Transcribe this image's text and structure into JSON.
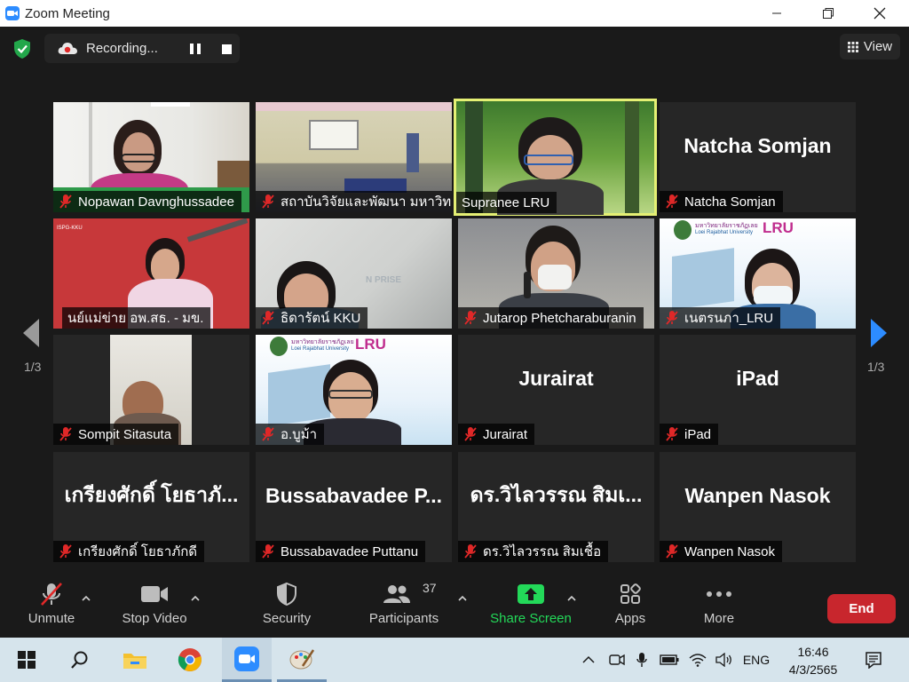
{
  "window": {
    "title": "Zoom Meeting"
  },
  "recording": {
    "label": "Recording..."
  },
  "view": {
    "label": "View"
  },
  "paging": {
    "left": "1/3",
    "right": "1/3"
  },
  "participants_tiles": [
    {
      "name": "Nopawan Davnghussadee",
      "display": "",
      "muted": true,
      "video": true
    },
    {
      "name": "สถาบันวิจัยและพัฒนา มหาวิท...",
      "display": "",
      "muted": true,
      "video": true
    },
    {
      "name": "Supranee LRU",
      "display": "",
      "muted": false,
      "video": true,
      "active": true
    },
    {
      "name": "Natcha Somjan",
      "display": "Natcha Somjan",
      "muted": true,
      "video": false
    },
    {
      "name": "นย์แม่ข่าย อพ.สธ. - มข.",
      "display": "",
      "muted": false,
      "video": true
    },
    {
      "name": "ธิดารัตน์ KKU",
      "display": "",
      "muted": true,
      "video": true
    },
    {
      "name": "Jutarop Phetcharaburanin",
      "display": "",
      "muted": true,
      "video": true
    },
    {
      "name": "เนตรนภา_LRU",
      "display": "",
      "muted": true,
      "video": true
    },
    {
      "name": "Sompit Sitasuta",
      "display": "",
      "muted": true,
      "video": true
    },
    {
      "name": "อ.บูม้า",
      "display": "",
      "muted": true,
      "video": true
    },
    {
      "name": "Jurairat",
      "display": "Jurairat",
      "muted": true,
      "video": false
    },
    {
      "name": "iPad",
      "display": "iPad",
      "muted": true,
      "video": false
    },
    {
      "name": "เกรียงศักดิ์ โยธาภักดี",
      "display": "เกรียงศักดิ์ โยธาภั...",
      "muted": true,
      "video": false
    },
    {
      "name": "Bussabavadee Puttanu",
      "display": "Bussabavadee P...",
      "muted": true,
      "video": false
    },
    {
      "name": "ดร.วิไลวรรณ สิมเชื้อ",
      "display": "ดร.วิไลวรรณ สิมเ...",
      "muted": true,
      "video": false
    },
    {
      "name": "Wanpen Nasok",
      "display": "Wanpen Nasok",
      "muted": true,
      "video": false
    }
  ],
  "overlay_text": {
    "lru_logo": "LRU",
    "lru_university_th": "มหาวิทยาลัยราชภัฏเลย",
    "lru_university_en": "Loei Rajabhat University",
    "kku_logo": "ISPG-KKU",
    "enterprise_sign": "N PRISE"
  },
  "toolbar": {
    "unmute": "Unmute",
    "stop_video": "Stop Video",
    "security": "Security",
    "participants": "Participants",
    "participants_count": "37",
    "share_screen": "Share Screen",
    "apps": "Apps",
    "more": "More",
    "end": "End"
  },
  "taskbar": {
    "lang": "ENG",
    "time": "16:46",
    "date": "4/3/2565"
  },
  "colors": {
    "zoom_blue": "#2d8cff",
    "share_green": "#23d959",
    "end_red": "#c8262d",
    "mute_red": "#e02828",
    "active_speaker": "#e5f074"
  }
}
